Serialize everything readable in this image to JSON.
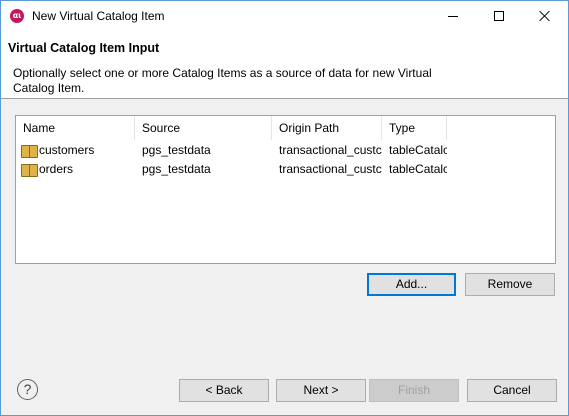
{
  "window": {
    "title": "New Virtual Catalog Item",
    "icon": "app-logo-icon"
  },
  "header": {
    "title": "Virtual Catalog Item Input",
    "description": "Optionally select one or more Catalog Items as a source of data for new Virtual Catalog Item."
  },
  "table": {
    "columns": [
      "Name",
      "Source",
      "Origin Path",
      "Type"
    ],
    "rows": [
      {
        "name": "customers",
        "source": "pgs_testdata",
        "origin": "transactional_custc",
        "type": "tableCatalc"
      },
      {
        "name": "orders",
        "source": "pgs_testdata",
        "origin": "transactional_custc",
        "type": "tableCatalc"
      }
    ]
  },
  "buttons": {
    "add": "Add...",
    "remove": "Remove",
    "back": "< Back",
    "next": "Next >",
    "finish": "Finish",
    "cancel": "Cancel",
    "help": "?"
  },
  "colors": {
    "accent": "#0078d7",
    "app_icon": "#c2185b"
  }
}
